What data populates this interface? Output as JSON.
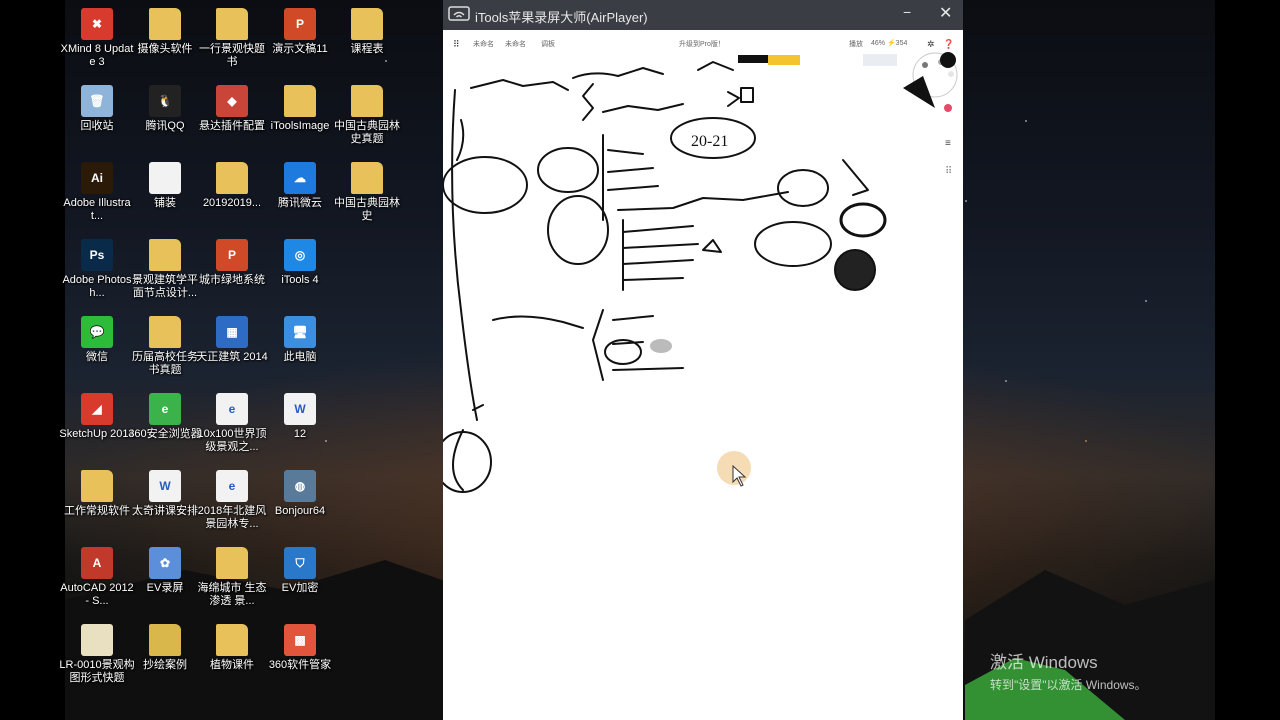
{
  "desktop_icons": [
    {
      "name": "xmind-icon",
      "label": "XMind 8 Update 3",
      "glyph": "✖",
      "color": "#d93a2e"
    },
    {
      "name": "folder-icon",
      "label": "摄像头软件",
      "glyph": "",
      "color": "#e8c15a"
    },
    {
      "name": "folder-icon",
      "label": "一行景观快题书",
      "glyph": "",
      "color": "#e8c15a"
    },
    {
      "name": "ppt-icon",
      "label": "演示文稿11",
      "glyph": "P",
      "color": "#d04a28"
    },
    {
      "name": "folder-icon",
      "label": "课程表",
      "glyph": "",
      "color": "#e8c15a"
    },
    {
      "name": "recycle-bin-icon",
      "label": "回收站",
      "glyph": "🗑",
      "color": "#8fb4d9"
    },
    {
      "name": "qq-icon",
      "label": "腾讯QQ",
      "glyph": "🐧",
      "color": "#222222"
    },
    {
      "name": "plugin-icon",
      "label": "悬达插件配置",
      "glyph": "◆",
      "color": "#c9453a"
    },
    {
      "name": "folder-icon",
      "label": "iToolsImage",
      "glyph": "",
      "color": "#e8c15a"
    },
    {
      "name": "folder-icon",
      "label": "中国古典园林史真题",
      "glyph": "",
      "color": "#e8c15a"
    },
    {
      "name": "illustrator-icon",
      "label": "Adobe Illustrat...",
      "glyph": "Ai",
      "color": "#2b1a08"
    },
    {
      "name": "doc-icon",
      "label": "铺装",
      "glyph": "",
      "color": "#f2f2f2"
    },
    {
      "name": "folder-icon",
      "label": "20192019...",
      "glyph": "",
      "color": "#e8c15a"
    },
    {
      "name": "cloud-icon",
      "label": "腾讯微云",
      "glyph": "☁",
      "color": "#1f7ae0"
    },
    {
      "name": "folder-icon",
      "label": "中国古典园林史",
      "glyph": "",
      "color": "#e8c15a"
    },
    {
      "name": "photoshop-icon",
      "label": "Adobe Photosh...",
      "glyph": "Ps",
      "color": "#0a2a4a"
    },
    {
      "name": "folder-icon",
      "label": "景观建筑学平面节点设计...",
      "glyph": "",
      "color": "#e8c15a"
    },
    {
      "name": "ppt-icon",
      "label": "城市绿地系统",
      "glyph": "P",
      "color": "#d04a28"
    },
    {
      "name": "itools-icon",
      "label": "iTools 4",
      "glyph": "◎",
      "color": "#1f88e5"
    },
    {
      "name": "spacer",
      "label": "",
      "glyph": "",
      "color": ""
    },
    {
      "name": "wechat-icon",
      "label": "微信",
      "glyph": "💬",
      "color": "#2dbb3a"
    },
    {
      "name": "folder-icon",
      "label": "历届高校任务书真题",
      "glyph": "",
      "color": "#e8c15a"
    },
    {
      "name": "tarch-icon",
      "label": "天正建筑 2014",
      "glyph": "▦",
      "color": "#2d6bc5"
    },
    {
      "name": "pc-icon",
      "label": "此电脑",
      "glyph": "🖥",
      "color": "#3a8fe0"
    },
    {
      "name": "spacer",
      "label": "",
      "glyph": "",
      "color": ""
    },
    {
      "name": "sketchup-icon",
      "label": "SketchUp 2014",
      "glyph": "◢",
      "color": "#d93a2e"
    },
    {
      "name": "browser-icon",
      "label": "360安全浏览器",
      "glyph": "e",
      "color": "#3bb34a"
    },
    {
      "name": "pdf-icon",
      "label": "10x100世界顶级景观之...",
      "glyph": "e",
      "color": "#f2f2f2"
    },
    {
      "name": "doc-icon",
      "label": "12",
      "glyph": "W",
      "color": "#f2f2f2"
    },
    {
      "name": "spacer",
      "label": "",
      "glyph": "",
      "color": ""
    },
    {
      "name": "folder-icon",
      "label": "工作常规软件",
      "glyph": "",
      "color": "#e8c15a"
    },
    {
      "name": "doc-icon",
      "label": "太奇讲课安排",
      "glyph": "W",
      "color": "#f2f2f2"
    },
    {
      "name": "pdf-icon",
      "label": "2018年北建风景园林专...",
      "glyph": "e",
      "color": "#f2f2f2"
    },
    {
      "name": "bonjour-icon",
      "label": "Bonjour64",
      "glyph": "◍",
      "color": "#5a7a9a"
    },
    {
      "name": "spacer",
      "label": "",
      "glyph": "",
      "color": ""
    },
    {
      "name": "autocad-icon",
      "label": "AutoCAD 2012 - S...",
      "glyph": "A",
      "color": "#c0392b"
    },
    {
      "name": "ev-record-icon",
      "label": "EV录屏",
      "glyph": "✿",
      "color": "#5b8fd9"
    },
    {
      "name": "folder-icon",
      "label": "海绵城市 生态渗透 景...",
      "glyph": "",
      "color": "#e8c15a"
    },
    {
      "name": "ev-encrypt-icon",
      "label": "EV加密",
      "glyph": "⛉",
      "color": "#2a78c9"
    },
    {
      "name": "spacer",
      "label": "",
      "glyph": "",
      "color": ""
    },
    {
      "name": "doc-icon",
      "label": "LR-0010景观构图形式快题",
      "glyph": "",
      "color": "#e8e0c0"
    },
    {
      "name": "folder-icon",
      "label": "抄绘案例",
      "glyph": "",
      "color": "#d9b74a"
    },
    {
      "name": "folder-icon",
      "label": "植物课件",
      "glyph": "",
      "color": "#e8c15a"
    },
    {
      "name": "software-manager-icon",
      "label": "360软件管家",
      "glyph": "▩",
      "color": "#e0553b"
    }
  ],
  "window": {
    "title": "iTools苹果录屏大师(AirPlayer)",
    "minimize": "−",
    "close": "✕"
  },
  "app_toolbar": {
    "items": [
      "未命名",
      "未命名",
      "调板",
      "升级到Pro版！",
      "播放",
      "46% ⚡354"
    ]
  },
  "watermark": {
    "line1": "激活 Windows",
    "line2": "转到\"设置\"以激活 Windows。"
  },
  "colors": {
    "titlebar": "#3a3d44",
    "ink": "#111111",
    "highlight_yellow": "#f4c430"
  }
}
